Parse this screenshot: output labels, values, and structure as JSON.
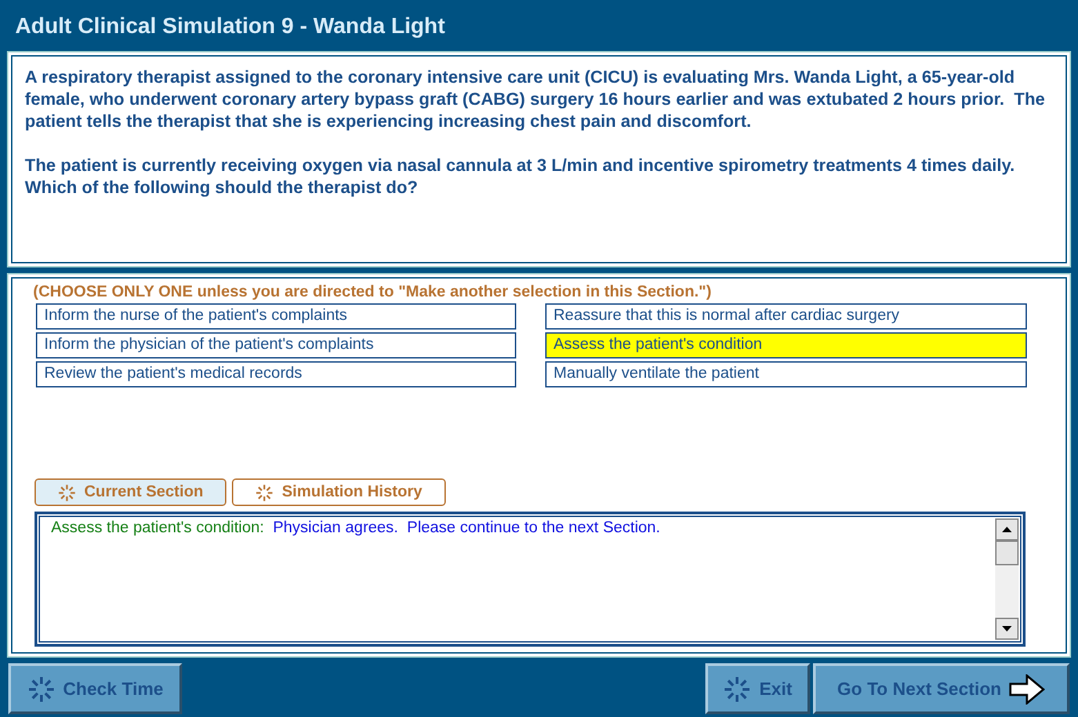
{
  "window": {
    "title": "Adult Clinical Simulation 9 - Wanda Light"
  },
  "scenario": [
    "A respiratory therapist assigned to the coronary intensive care unit (CICU) is evaluating Mrs. Wanda Light, a 65-year-old female, who underwent coronary artery bypass graft (CABG) surgery 16 hours earlier and was extubated 2 hours prior.  The patient tells the therapist that she is experiencing increasing chest pain and discomfort.",
    "The patient is currently receiving oxygen via nasal cannula at 3 L/min and incentive spirometry treatments 4 times daily.   Which of the following should the therapist do?"
  ],
  "instruction": "(CHOOSE ONLY ONE unless you are directed to \"Make another selection in this Section.\")",
  "options": [
    {
      "label": "Inform the nurse of the patient's complaints",
      "selected": false
    },
    {
      "label": "Reassure that this is normal after cardiac surgery",
      "selected": false
    },
    {
      "label": "Inform the physician of the patient's complaints",
      "selected": false
    },
    {
      "label": "Assess the patient's condition",
      "selected": true
    },
    {
      "label": "Review the patient's medical records",
      "selected": false
    },
    {
      "label": "Manually ventilate the patient",
      "selected": false
    }
  ],
  "tabs": [
    {
      "label": "Current Section",
      "selected": true
    },
    {
      "label": "Simulation History",
      "selected": false
    }
  ],
  "feedback": {
    "choice": "Assess the patient's condition:",
    "response": "Physician agrees.  Please continue to the next Section."
  },
  "buttons": {
    "check_time": "Check Time",
    "exit": "Exit",
    "next": "Go To Next Section"
  }
}
